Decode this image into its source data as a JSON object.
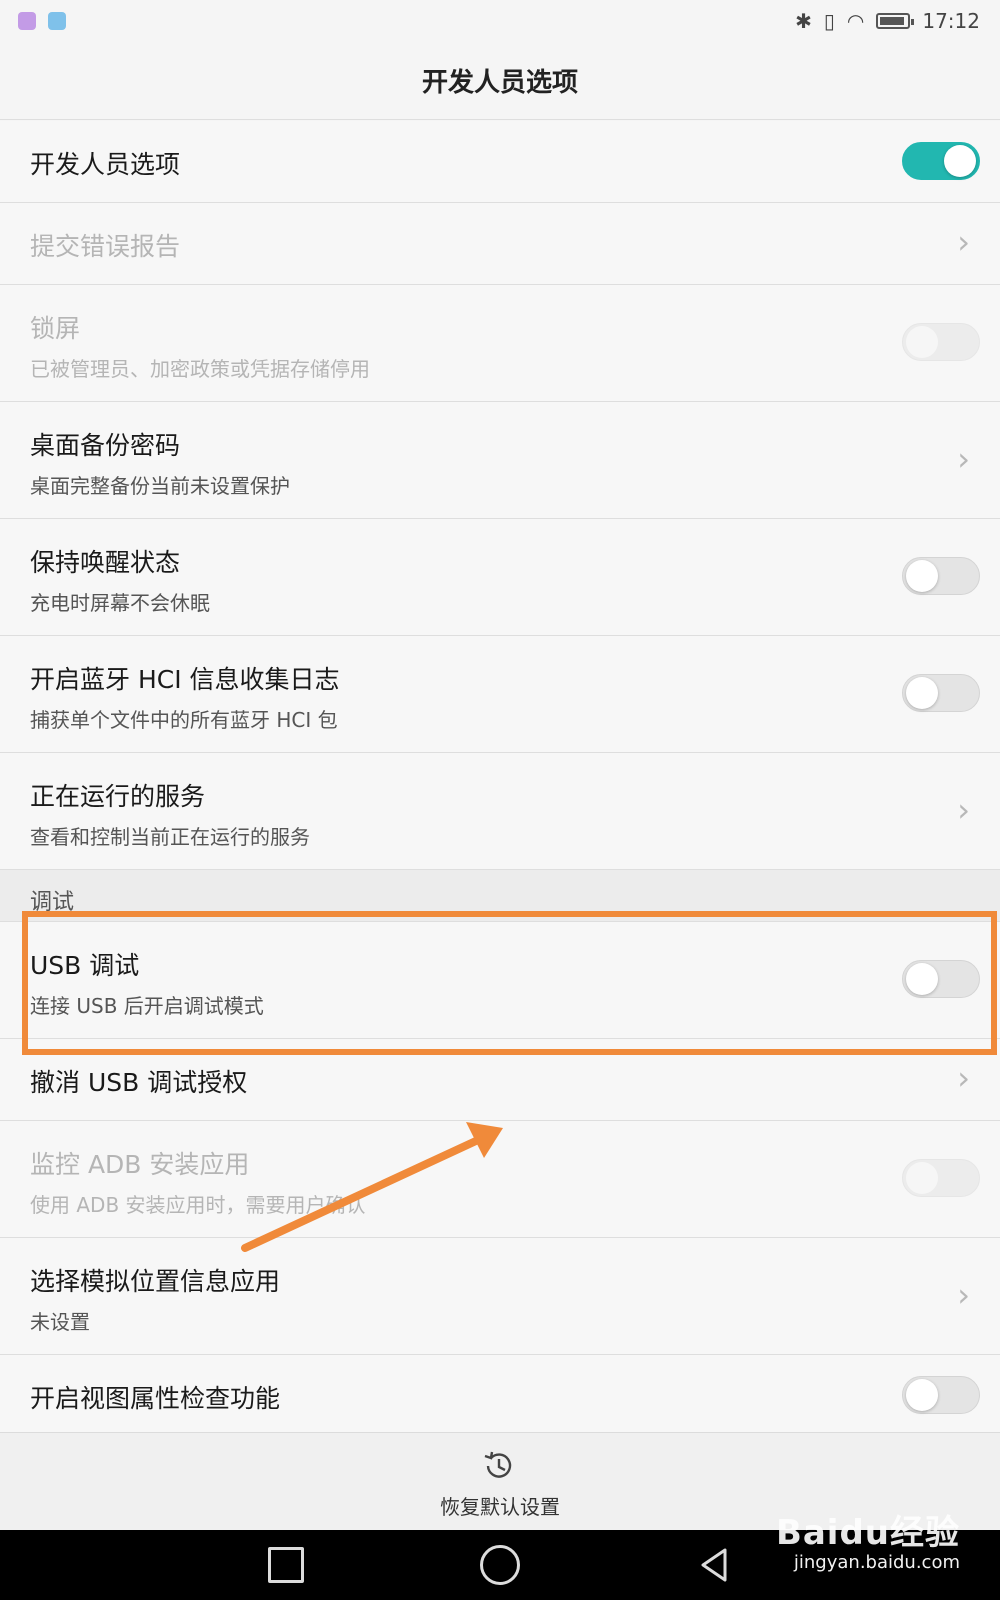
{
  "status_bar": {
    "time": "17:12",
    "icons": [
      "bluetooth-icon",
      "vibrate-icon",
      "wifi-icon",
      "battery-icon"
    ]
  },
  "header": {
    "title": "开发人员选项"
  },
  "rows": [
    {
      "title": "开发人员选项",
      "toggle": "on"
    },
    {
      "title": "提交错误报告",
      "disabled": true,
      "control": "chevron"
    },
    {
      "title": "锁屏",
      "subtitle": "已被管理员、加密政策或凭据存储停用",
      "disabled": true,
      "toggle": "disabled"
    },
    {
      "title": "桌面备份密码",
      "subtitle": "桌面完整备份当前未设置保护",
      "control": "chevron"
    },
    {
      "title": "保持唤醒状态",
      "subtitle": "充电时屏幕不会休眠",
      "toggle": "off"
    },
    {
      "title": "开启蓝牙 HCI 信息收集日志",
      "subtitle": "捕获单个文件中的所有蓝牙 HCI 包",
      "toggle": "off"
    },
    {
      "title": "正在运行的服务",
      "subtitle": "查看和控制当前正在运行的服务",
      "control": "chevron"
    }
  ],
  "section": {
    "label": "调试"
  },
  "debug_rows": [
    {
      "title": "USB 调试",
      "subtitle": "连接 USB 后开启调试模式",
      "toggle": "off"
    },
    {
      "title": "撤消 USB 调试授权",
      "control": "chevron"
    },
    {
      "title": "监控 ADB 安装应用",
      "subtitle": "使用 ADB 安装应用时，需要用户确认",
      "disabled": true,
      "toggle": "disabled"
    },
    {
      "title": "选择模拟位置信息应用",
      "subtitle": "未设置",
      "control": "chevron"
    },
    {
      "title": "开启视图属性检查功能",
      "toggle": "off"
    }
  ],
  "footer": {
    "restore_label": "恢复默认设置"
  },
  "watermark": {
    "brand": "Baidu经验",
    "url": "jingyan.baidu.com"
  },
  "colors": {
    "accent": "#22b7b0",
    "annotation": "#f08a3a"
  }
}
